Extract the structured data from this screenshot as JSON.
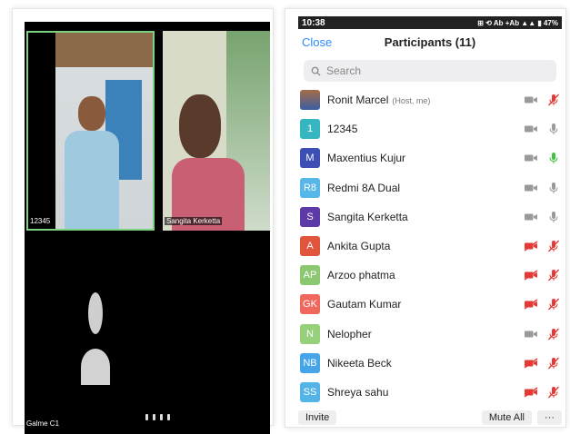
{
  "status_bar": {
    "time": "10:38",
    "right": "⊞ ⟲ Ab +Ab ▲▲ ▮ 47%"
  },
  "header": {
    "close_label": "Close",
    "title": "Participants (11)"
  },
  "search": {
    "placeholder": "Search"
  },
  "gallery": {
    "tile1_name": "12345",
    "tile2_name": "Sangita Kerketta",
    "bottom_name": "Galme C1"
  },
  "participants": [
    {
      "initials": "",
      "name": "Ronit Marcel",
      "sub": "(Host, me)",
      "color": "#3c5ba0",
      "photo": true,
      "video": "on",
      "audio": "muted"
    },
    {
      "initials": "1",
      "name": "12345",
      "sub": "",
      "color": "#36b6c0",
      "photo": false,
      "video": "on",
      "audio": "on"
    },
    {
      "initials": "M",
      "name": "Maxentius Kujur",
      "sub": "",
      "color": "#3d4fb5",
      "photo": false,
      "video": "on",
      "audio": "speaking"
    },
    {
      "initials": "R8",
      "name": "Redmi 8A Dual",
      "sub": "",
      "color": "#56b7e8",
      "photo": false,
      "video": "on",
      "audio": "on"
    },
    {
      "initials": "S",
      "name": "Sangita Kerketta",
      "sub": "",
      "color": "#5e3aa9",
      "photo": false,
      "video": "on",
      "audio": "on"
    },
    {
      "initials": "A",
      "name": "Ankita Gupta",
      "sub": "",
      "color": "#e0553b",
      "photo": false,
      "video": "off",
      "audio": "muted"
    },
    {
      "initials": "AP",
      "name": "Arzoo phatma",
      "sub": "",
      "color": "#8cc872",
      "photo": false,
      "video": "off",
      "audio": "muted"
    },
    {
      "initials": "GK",
      "name": "Gautam Kumar",
      "sub": "",
      "color": "#f0675e",
      "photo": false,
      "video": "off",
      "audio": "muted"
    },
    {
      "initials": "N",
      "name": "Nelopher",
      "sub": "",
      "color": "#97d07b",
      "photo": false,
      "video": "on",
      "audio": "muted"
    },
    {
      "initials": "NB",
      "name": "Nikeeta Beck",
      "sub": "",
      "color": "#46a4e8",
      "photo": false,
      "video": "off",
      "audio": "muted"
    },
    {
      "initials": "SS",
      "name": "Shreya sahu",
      "sub": "",
      "color": "#54b4e6",
      "photo": false,
      "video": "off",
      "audio": "muted"
    }
  ],
  "footer": {
    "invite_label": "Invite",
    "mute_all_label": "Mute All",
    "more_label": "···"
  },
  "colors": {
    "accent": "#2d8cff",
    "muted_red": "#e53935",
    "speaking_green": "#43c443",
    "icon_gray": "#9a9a9a"
  }
}
